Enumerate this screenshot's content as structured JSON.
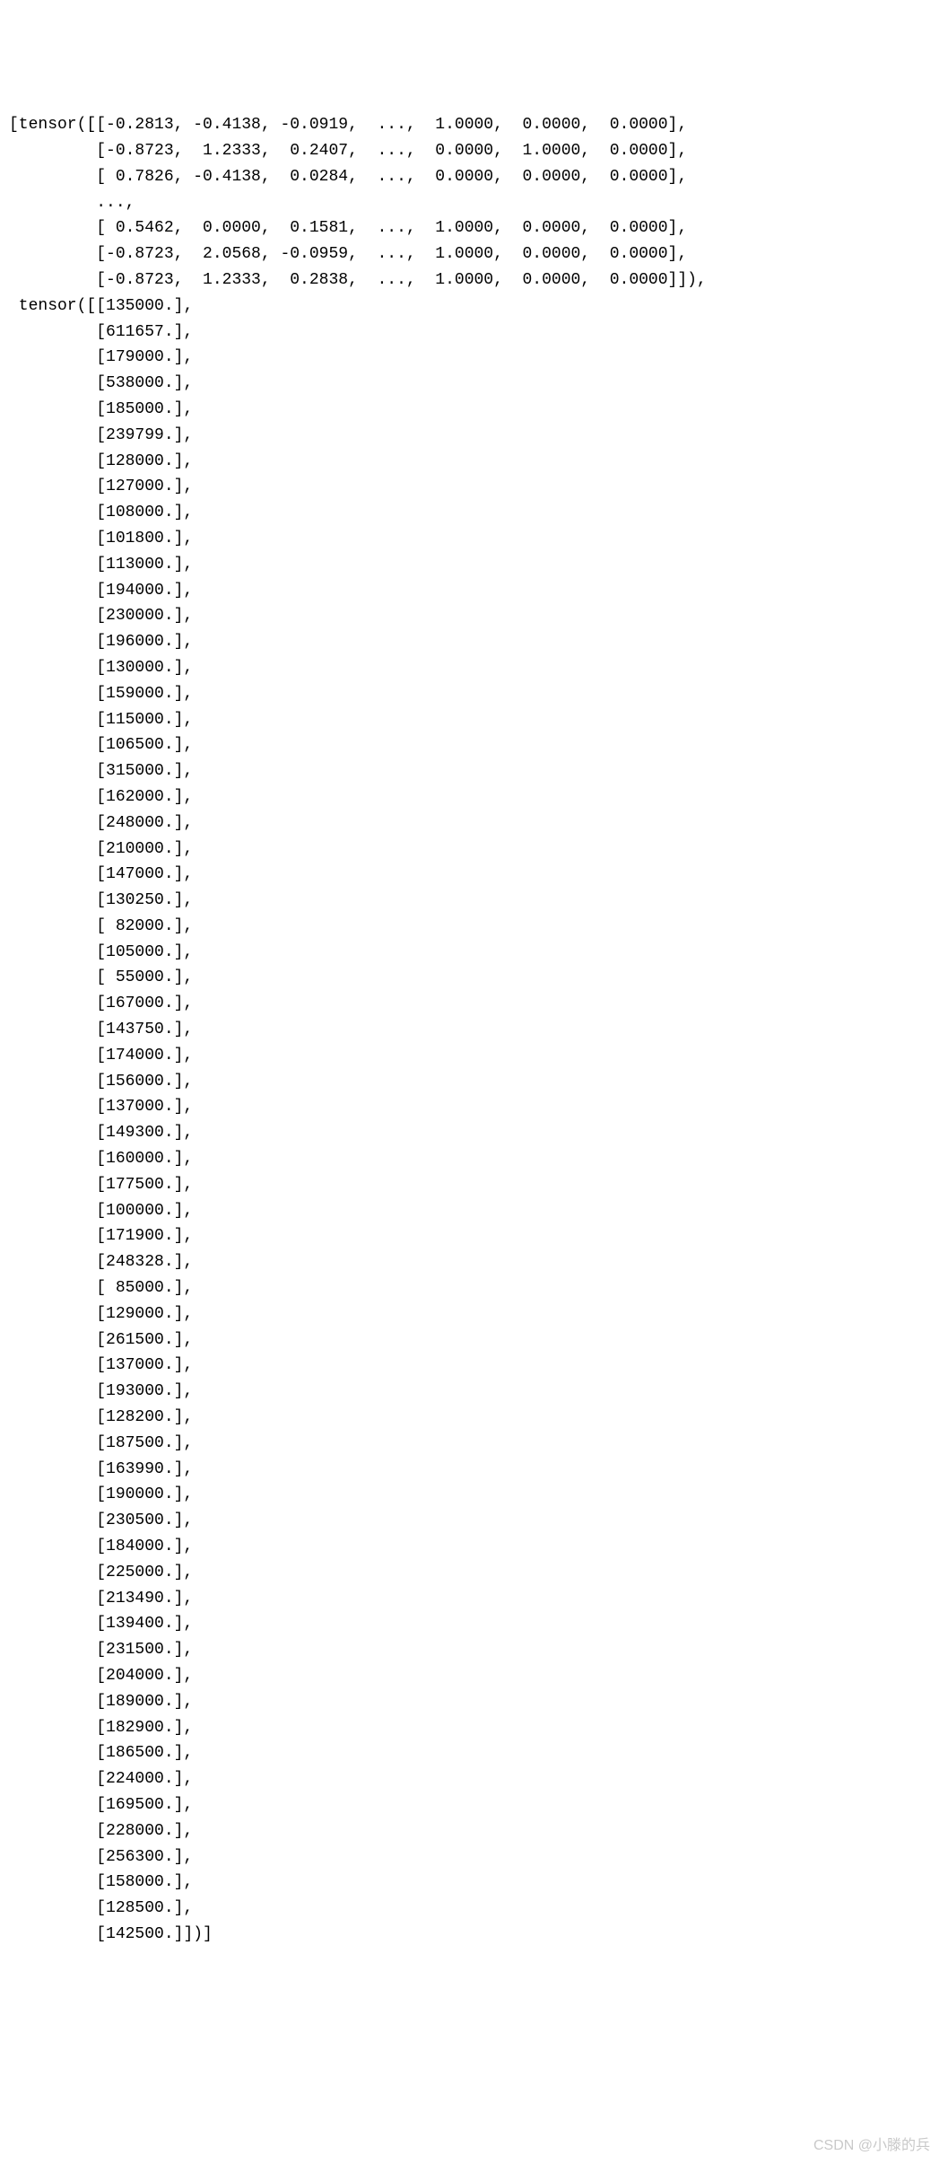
{
  "tensor1": {
    "prefix": "[tensor(",
    "rows_head": [
      "[[-0.2813, -0.4138, -0.0919,  ...,  1.0000,  0.0000,  0.0000],",
      " [-0.8723,  1.2333,  0.2407,  ...,  0.0000,  1.0000,  0.0000],",
      " [ 0.7826, -0.4138,  0.0284,  ...,  0.0000,  0.0000,  0.0000],",
      " ...,",
      " [ 0.5462,  0.0000,  0.1581,  ...,  1.0000,  0.0000,  0.0000],",
      " [-0.8723,  2.0568, -0.0959,  ...,  1.0000,  0.0000,  0.0000],",
      " [-0.8723,  1.2333,  0.2838,  ...,  1.0000,  0.0000,  0.0000]]),"
    ]
  },
  "tensor2": {
    "prefix": " tensor(",
    "first_row": "[[135000.],",
    "values": [
      "611657.",
      "179000.",
      "538000.",
      "185000.",
      "239799.",
      "128000.",
      "127000.",
      "108000.",
      "101800.",
      "113000.",
      "194000.",
      "230000.",
      "196000.",
      "130000.",
      "159000.",
      "115000.",
      "106500.",
      "315000.",
      "162000.",
      "248000.",
      "210000.",
      "147000.",
      "130250.",
      " 82000.",
      "105000.",
      " 55000.",
      "167000.",
      "143750.",
      "174000.",
      "156000.",
      "137000.",
      "149300.",
      "160000.",
      "177500.",
      "100000.",
      "171900.",
      "248328.",
      " 85000.",
      "129000.",
      "261500.",
      "137000.",
      "193000.",
      "128200.",
      "187500.",
      "163990.",
      "190000.",
      "230500.",
      "184000.",
      "225000.",
      "213490.",
      "139400.",
      "231500.",
      "204000.",
      "189000.",
      "182900.",
      "186500.",
      "224000.",
      "169500.",
      "228000.",
      "256300.",
      "158000.",
      "128500."
    ],
    "last_row": " [142500.]])]"
  },
  "watermark": "CSDN @小滕的兵"
}
